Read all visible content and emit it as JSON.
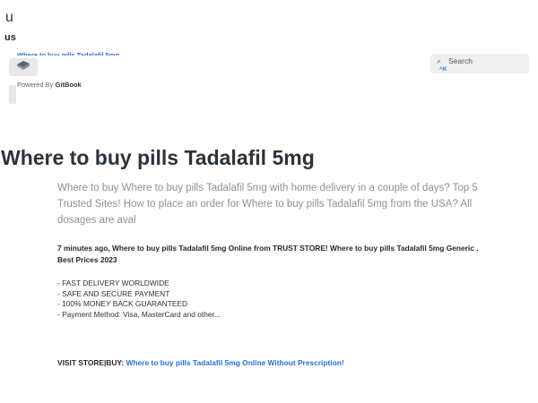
{
  "top": {
    "u": "u",
    "us": "us"
  },
  "header": {
    "site_title": "Where to buy pills Tadalafil 5mg",
    "powered_prefix": "Powered By",
    "powered_brand": "GitBook",
    "search": {
      "icon": "search-icon",
      "label": "Search",
      "shortcut": "^K"
    }
  },
  "main": {
    "title": "Where to buy pills Tadalafil 5mg",
    "lead": "Where to buy Where to buy pills Tadalafil 5mg with home delivery in a couple of days? Top 5 Trusted Sites! How to place an order for Where to buy pills Tadalafil 5mg from the USA? All dosages are aval",
    "news": "7 minutes ago, Where to buy pills Tadalafil 5mg Online from TRUST STORE! Where to buy pills Tadalafil 5mg Generic . Best Prices 2023",
    "features": [
      "- FAST DELIVERY WORLDWIDE",
      "- SAFE AND SECURE PAYMENT",
      "- 100% MONEY BACK GUARANTEED",
      "- Payment Method: Visa, MasterCard and other..."
    ],
    "visit_prefix": "VISIT STORE|BUY: ",
    "visit_link": "Where to buy pills Tadalafil 5mg Online Without Prescription!"
  }
}
